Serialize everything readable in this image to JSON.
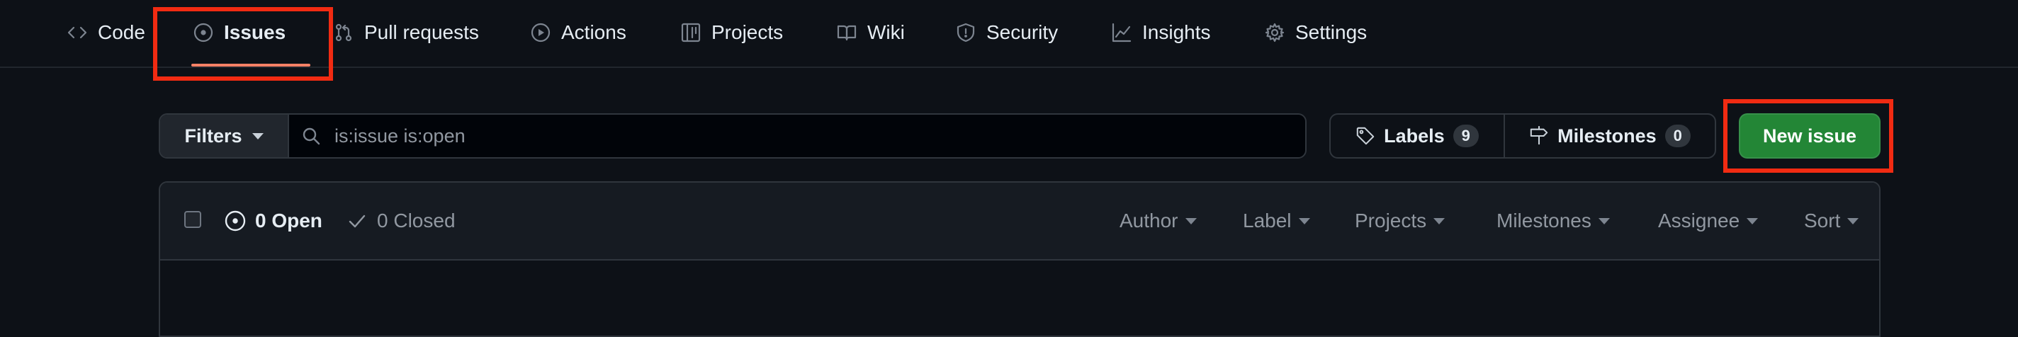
{
  "repo_nav": {
    "tabs": [
      {
        "label": "Code",
        "icon": "code-icon"
      },
      {
        "label": "Issues",
        "icon": "issue-opened-icon",
        "active": true
      },
      {
        "label": "Pull requests",
        "icon": "git-pull-request-icon"
      },
      {
        "label": "Actions",
        "icon": "play-icon"
      },
      {
        "label": "Projects",
        "icon": "table-icon"
      },
      {
        "label": "Wiki",
        "icon": "book-icon"
      },
      {
        "label": "Security",
        "icon": "shield-icon"
      },
      {
        "label": "Insights",
        "icon": "graph-icon"
      },
      {
        "label": "Settings",
        "icon": "gear-icon"
      }
    ]
  },
  "filter_bar": {
    "filters_label": "Filters",
    "search_value": "is:issue is:open",
    "labels_label": "Labels",
    "labels_count": "9",
    "milestones_label": "Milestones",
    "milestones_count": "0",
    "new_issue_label": "New issue"
  },
  "issues_header": {
    "open_label": "0 Open",
    "closed_label": "0 Closed",
    "filters": [
      "Author",
      "Label",
      "Projects",
      "Milestones",
      "Assignee",
      "Sort"
    ]
  },
  "colors": {
    "background": "#0d1117",
    "primary_button": "#238636",
    "active_tab_underline": "#f78166",
    "highlight_box": "#f12b12"
  }
}
